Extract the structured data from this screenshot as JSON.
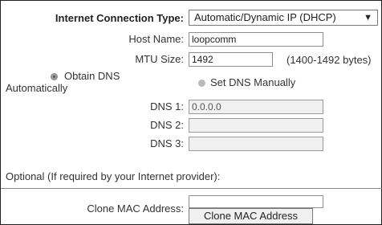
{
  "connection_type": {
    "label": "Internet Connection Type:",
    "selected": "Automatic/Dynamic IP (DHCP)"
  },
  "host_name": {
    "label": "Host Name:",
    "value": "loopcomm"
  },
  "mtu_size": {
    "label": "MTU Size:",
    "value": "1492",
    "hint": "(1400-1492 bytes)"
  },
  "dns_mode": {
    "obtain_label_line1": "Obtain DNS",
    "obtain_label_line2": "Automatically",
    "manual_label": "Set DNS Manually",
    "selected": "obtain"
  },
  "dns": [
    {
      "label": "DNS 1:",
      "value": "0.0.0.0"
    },
    {
      "label": "DNS 2:",
      "value": ""
    },
    {
      "label": "DNS 3:",
      "value": ""
    }
  ],
  "optional_note": "Optional (If required by your Internet provider):",
  "clone_mac": {
    "label": "Clone MAC Address:",
    "value": "",
    "button_label": "Clone MAC Address"
  }
}
